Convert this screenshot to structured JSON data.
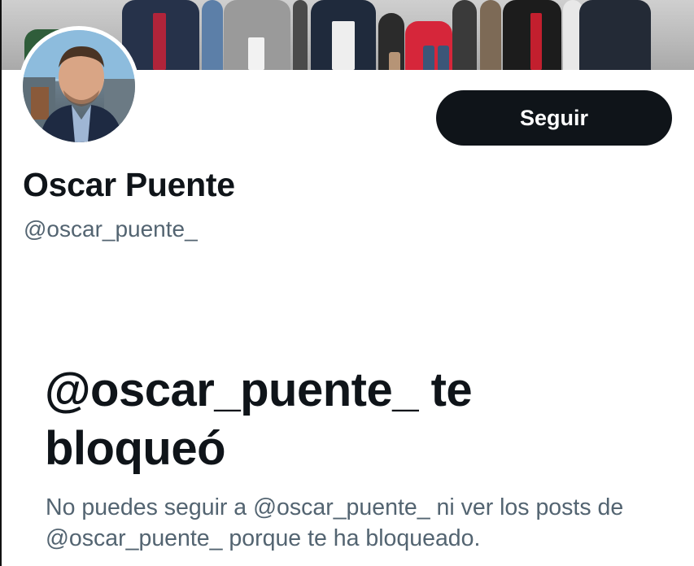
{
  "profile": {
    "display_name": "Oscar Puente",
    "handle": "@oscar_puente_",
    "follow_label": "Seguir"
  },
  "blocked_notice": {
    "title": "@oscar_puente_ te bloqueó",
    "description": "No puedes seguir a @oscar_puente_ ni ver los posts de @oscar_puente_ porque te ha bloqueado."
  },
  "colors": {
    "text_primary": "#0f1419",
    "text_secondary": "#536471",
    "button_bg": "#0f1419",
    "button_text": "#ffffff",
    "background": "#ffffff"
  }
}
